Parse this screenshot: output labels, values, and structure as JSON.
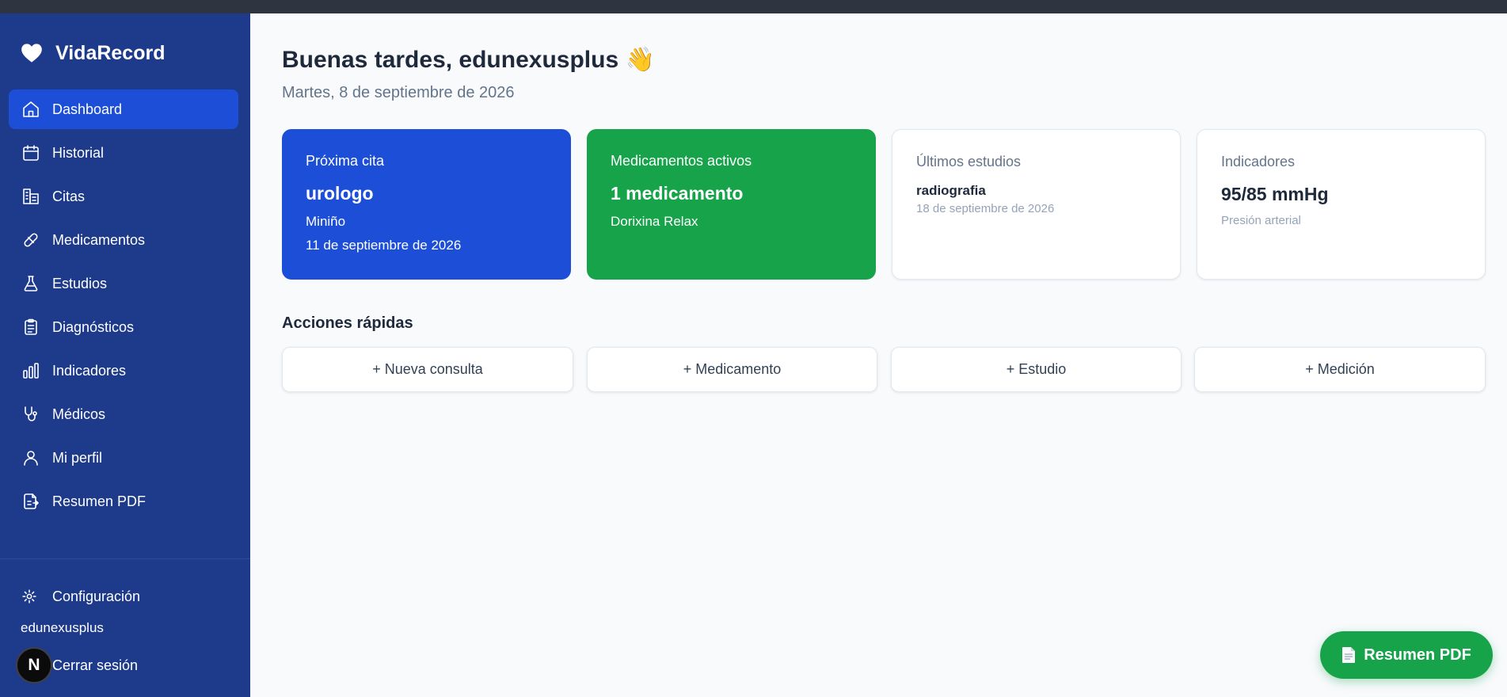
{
  "app": {
    "name": "VidaRecord",
    "logo_icon": "heart-icon"
  },
  "sidebar": {
    "items": [
      {
        "label": "Dashboard",
        "icon": "home-icon",
        "active": true
      },
      {
        "label": "Historial",
        "icon": "calendar-icon"
      },
      {
        "label": "Citas",
        "icon": "building-icon"
      },
      {
        "label": "Medicamentos",
        "icon": "pill-icon"
      },
      {
        "label": "Estudios",
        "icon": "flask-icon"
      },
      {
        "label": "Diagnósticos",
        "icon": "clipboard-icon"
      },
      {
        "label": "Indicadores",
        "icon": "bar-chart-icon"
      },
      {
        "label": "Médicos",
        "icon": "stethoscope-icon"
      },
      {
        "label": "Mi perfil",
        "icon": "user-icon"
      },
      {
        "label": "Resumen PDF",
        "icon": "file-export-icon"
      }
    ],
    "settings_label": "Configuración",
    "username": "edunexusplus",
    "logout_label": "Cerrar sesión",
    "badge_letter": "N"
  },
  "header": {
    "greeting": "Buenas tardes, edunexusplus 👋",
    "date": "Martes, 8 de septiembre de 2026"
  },
  "cards": {
    "next_appointment": {
      "label": "Próxima cita",
      "title": "urologo",
      "doctor": "Miniño",
      "date": "11 de septiembre de 2026",
      "color": "#1d4ed8"
    },
    "active_meds": {
      "label": "Medicamentos activos",
      "title": "1 medicamento",
      "detail": "Dorixina Relax",
      "color": "#16a34a"
    },
    "latest_studies": {
      "label": "Últimos estudios",
      "name": "radiografia",
      "date": "18 de septiembre de 2026"
    },
    "indicators": {
      "label": "Indicadores",
      "value": "95/85 mmHg",
      "type": "Presión arterial"
    }
  },
  "quick_actions": {
    "title": "Acciones rápidas",
    "buttons": [
      "+ Nueva consulta",
      "+ Medicamento",
      "+ Estudio",
      "+ Medición"
    ]
  },
  "fab": {
    "label": "Resumen PDF",
    "icon": "document-icon",
    "color": "#16a34a"
  }
}
